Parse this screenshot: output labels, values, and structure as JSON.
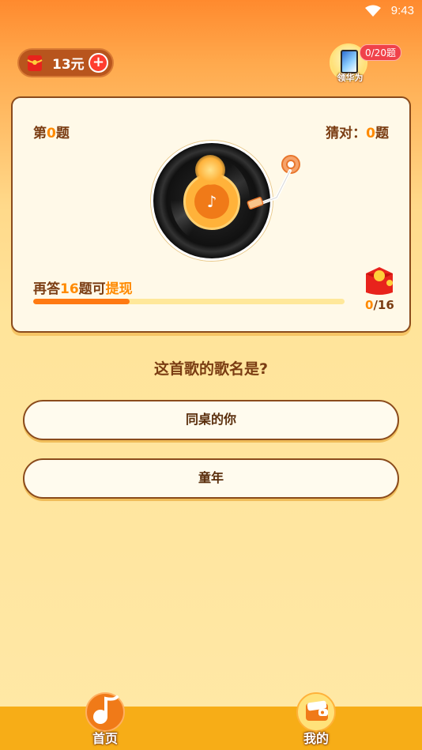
{
  "status_bar": {
    "time": "9:43"
  },
  "header": {
    "coin_amount": "13元",
    "plus_symbol": "+",
    "reward": {
      "label": "领华为",
      "badge": "0/20题"
    }
  },
  "card": {
    "question_prefix": "第",
    "question_number": "0",
    "question_suffix": "题",
    "correct_prefix": "猜对：",
    "correct_number": "0",
    "correct_suffix": "题",
    "progress_text_a": "再答",
    "progress_number": "16",
    "progress_text_b": "题可",
    "progress_text_c": "提现",
    "progress_value": 0.31,
    "redpacket_current": "0",
    "redpacket_total": "/16"
  },
  "question": "这首歌的歌名是?",
  "options": [
    "同桌的你",
    "童年"
  ],
  "nav": {
    "home_label": "首页",
    "mine_label": "我的"
  },
  "colors": {
    "accent": "#ff8a00",
    "text": "#7a3c12",
    "nav_bar": "#f7ad17",
    "progress": "#ff7a12"
  }
}
